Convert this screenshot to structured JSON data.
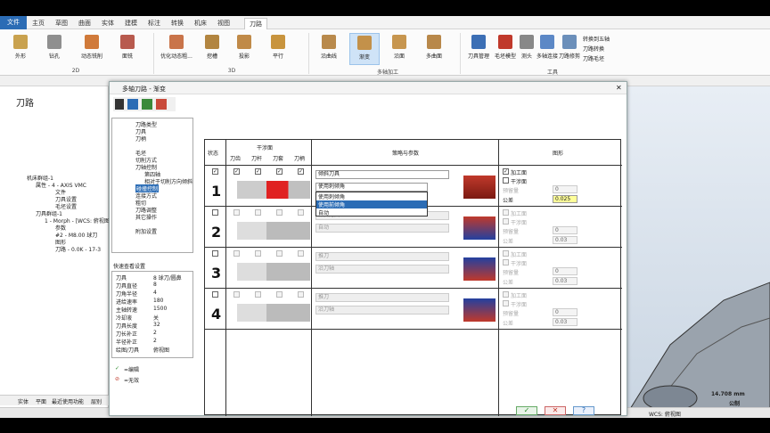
{
  "ribbon_tabs": [
    "文件",
    "主页",
    "草图",
    "曲面",
    "实体",
    "建模",
    "标注",
    "转换",
    "机床",
    "视图",
    "刀路"
  ],
  "ribbon": {
    "buttons": [
      "外形",
      "钻孔",
      "动态铣削",
      "面铣",
      "优化动态粗...",
      "挖槽",
      "投影",
      "平行",
      "沿曲线",
      "渐变",
      "沿面",
      "多曲面",
      "刀具管理",
      "毛坯模型",
      "测头",
      "多轴连接",
      "刀路修剪",
      "转换到五轴",
      "刀路转换",
      "刀路毛坯"
    ],
    "groups": [
      "2D",
      "3D",
      "多轴加工",
      "工具"
    ]
  },
  "left_panel": {
    "title": "刀路",
    "tree": [
      "机床群组-1",
      "属性 - 4 - AXIS VMC",
      "文件",
      "刀具设置",
      "毛坯设置",
      "刀具群组-1",
      "1 - Morph - [WCS: 俯视图]",
      "参数",
      "#2 - M8.00 球刀",
      "图形",
      "刀路 - 0.0K - 17-3"
    ],
    "bottom_tabs": [
      "实体",
      "平面",
      "最近使用功能",
      "层别"
    ]
  },
  "statusbar": {
    "wcs": "WCS: 俯视图",
    "scale": "14.708 mm",
    "unit": "公制",
    "view_label": "视图"
  },
  "dialog": {
    "title": "多轴刀路 - 渐变",
    "close": "✕",
    "nav": [
      "刀路类型",
      "刀具",
      "刀柄",
      "毛坯",
      "切削方式",
      "刀轴控制",
      "第四轴",
      "相对于切削方向倾斜",
      "碰撞控制",
      "连接方式",
      "粗切",
      "刀路调整",
      "其它操作",
      "附加设置"
    ],
    "quick_title": "快速查看设置",
    "quick": [
      [
        "刀具",
        "8 球刀/圆鼻"
      ],
      [
        "刀具直径",
        "8"
      ],
      [
        "刀角半径",
        "4"
      ],
      [
        "进给速率",
        "180"
      ],
      [
        "主轴转速",
        "1500"
      ],
      [
        "冷却液",
        "关"
      ],
      [
        "刀具长度",
        "32"
      ],
      [
        "刀长补正",
        "2"
      ],
      [
        "半径补正",
        "2"
      ],
      [
        "绘图/刀具",
        "俯视图"
      ]
    ],
    "legend_edit": "=编辑",
    "legend_invalid": "=无效",
    "headers": {
      "state": "状态",
      "interfere": "干涉面",
      "strategy": "策略与参数",
      "graphics": "图形",
      "cols": [
        "刀齿",
        "刀杆",
        "刀套",
        "刀柄"
      ]
    },
    "rows": [
      {
        "num": "1",
        "dd1": "倾斜刀具",
        "dd2": "使用刺倾角",
        "g1": "加工面",
        "g2": "干涉面",
        "v1l": "预留量",
        "v1": "0",
        "v2l": "公差",
        "v2": "0.025"
      },
      {
        "num": "2",
        "dd1": "倾斜刀具",
        "dd2": "自动",
        "g1": "加工面",
        "g2": "干涉面",
        "v1l": "预留量",
        "v1": "0",
        "v2l": "公差",
        "v2": "0.03"
      },
      {
        "num": "3",
        "dd1": "推刀",
        "dd2": "沿刀轴",
        "g1": "加工面",
        "g2": "干涉面",
        "v1l": "预留量",
        "v1": "0",
        "v2l": "公差",
        "v2": "0.03"
      },
      {
        "num": "4",
        "dd1": "推刀",
        "dd2": "沿刀轴",
        "g1": "加工面",
        "g2": "干涉面",
        "v1l": "预留量",
        "v1": "0",
        "v2l": "公差",
        "v2": "0.03"
      }
    ],
    "dropdown_options": [
      "使用刺倾角",
      "使用前倾角",
      "自动"
    ],
    "ok": "✓",
    "cancel": "✕",
    "help": "?"
  }
}
